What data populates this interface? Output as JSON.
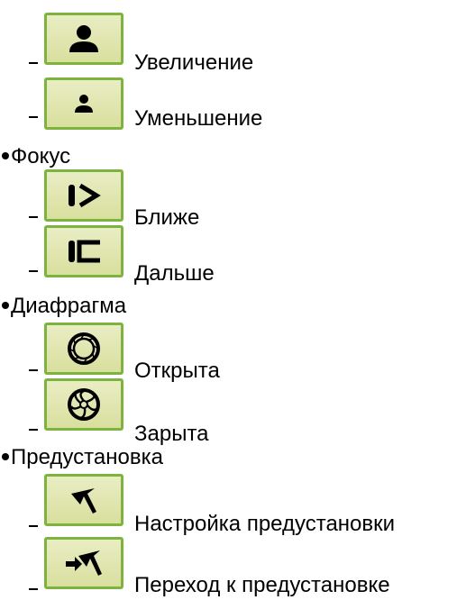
{
  "sections": [
    {
      "heading": null,
      "items": [
        {
          "label": "Увеличение",
          "icon": "zoom-in-person-icon"
        },
        {
          "label": "Уменьшение",
          "icon": "zoom-out-person-icon"
        }
      ]
    },
    {
      "heading": "Фокус",
      "items": [
        {
          "label": "Ближе",
          "icon": "focus-near-icon"
        },
        {
          "label": "Дальше",
          "icon": "focus-far-icon"
        }
      ]
    },
    {
      "heading": "Диафрагма",
      "items": [
        {
          "label": "Открыта",
          "icon": "iris-open-icon"
        },
        {
          "label": "Зарыта",
          "icon": "iris-close-icon"
        }
      ]
    },
    {
      "heading": "Предустановка",
      "items": [
        {
          "label": "Настройка предустановки",
          "icon": "preset-set-icon"
        },
        {
          "label": "Переход к предустановке",
          "icon": "preset-goto-icon"
        }
      ]
    }
  ],
  "theme": {
    "button_fill": "#dde3a8",
    "button_border": "#7cb43e"
  }
}
